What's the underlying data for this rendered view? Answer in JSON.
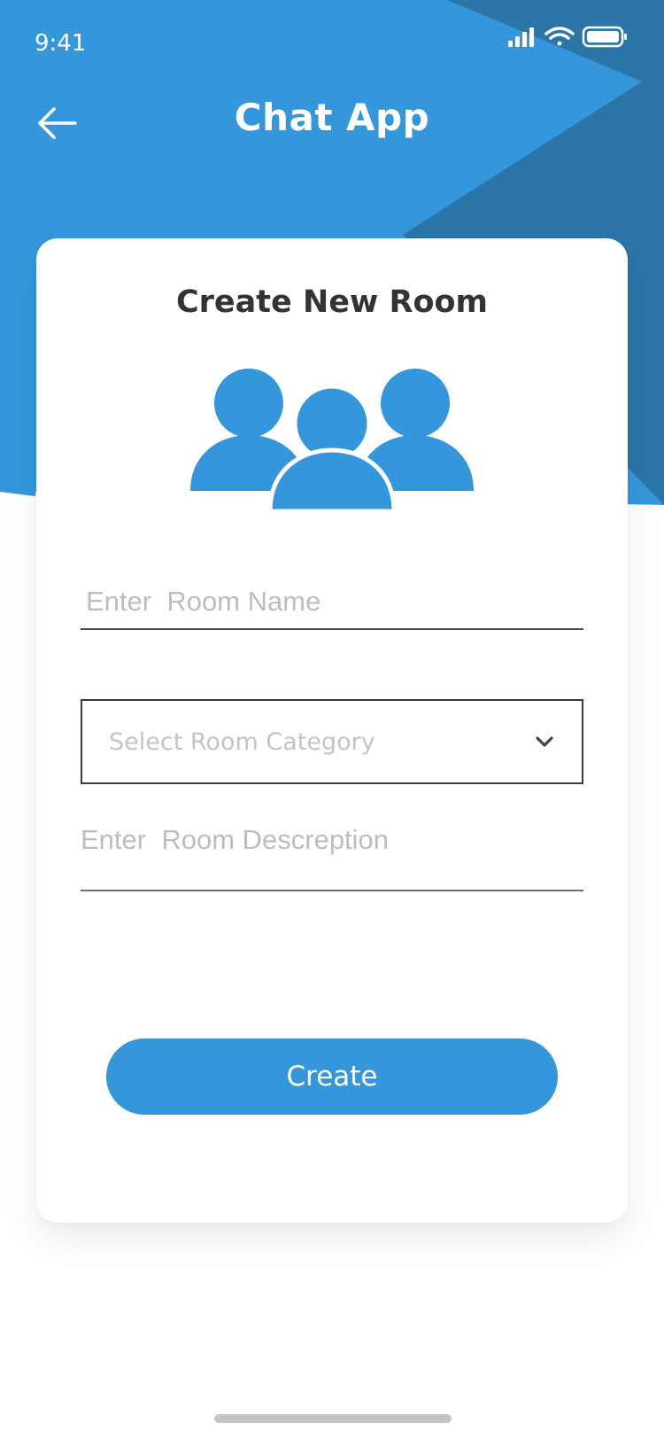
{
  "status_bar": {
    "time": "9:41"
  },
  "header": {
    "title": "Chat App"
  },
  "card": {
    "title": "Create New Room",
    "room_name_placeholder": "Enter  Room Name",
    "category_placeholder": "Select Room Category",
    "description_placeholder": "Enter  Room Descreption",
    "create_label": "Create"
  },
  "colors": {
    "primary": "#3597db",
    "primary_dark": "#2c75a8",
    "title_text": "#333333",
    "placeholder": "#bdbdbd"
  },
  "icons": {
    "back": "arrow-left-icon",
    "group": "users-group-icon",
    "dropdown": "chevron-down-icon"
  }
}
